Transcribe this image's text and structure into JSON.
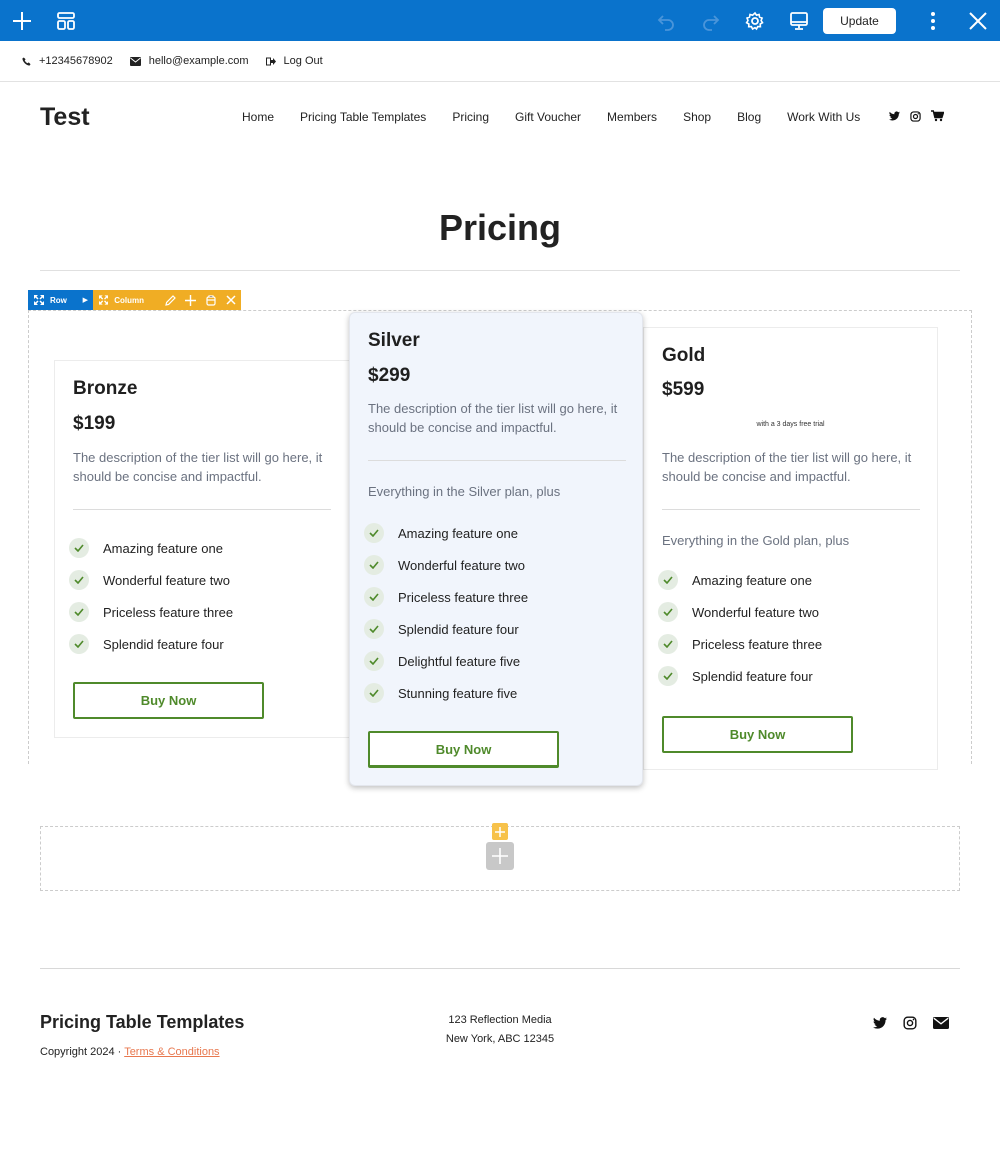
{
  "editor": {
    "update_label": "Update",
    "icons": [
      "plus-icon",
      "layout-icon",
      "undo-icon",
      "redo-icon",
      "settings-icon",
      "desktop-preview-icon",
      "more-vertical-icon",
      "close-icon"
    ],
    "accent": "#0a73cc"
  },
  "topbar": {
    "phone": "+12345678902",
    "email": "hello@example.com",
    "logout": "Log Out"
  },
  "header": {
    "site_title": "Test",
    "nav": [
      "Home",
      "Pricing Table Templates",
      "Pricing",
      "Gift Voucher",
      "Members",
      "Shop",
      "Blog",
      "Work With Us"
    ],
    "icons": [
      "twitter-icon",
      "instagram-icon",
      "cart-icon"
    ]
  },
  "page": {
    "title": "Pricing"
  },
  "builder": {
    "row_label": "Row",
    "column_label": "Column"
  },
  "plans": [
    {
      "name": "Bronze",
      "price": "$199",
      "description": "The description of the tier list will go here, it should be concise and impactful.",
      "features": [
        "Amazing feature one",
        "Wonderful feature two",
        "Priceless feature three",
        "Splendid feature four"
      ],
      "cta": "Buy Now"
    },
    {
      "name": "Silver",
      "price": "$299",
      "description": "The description of the tier list will go here, it should be concise and impactful.",
      "includes": "Everything in the Silver plan, plus",
      "features": [
        "Amazing feature one",
        "Wonderful feature two",
        "Priceless feature three",
        "Splendid feature four",
        "Delightful feature five",
        "Stunning feature five"
      ],
      "cta": "Buy Now"
    },
    {
      "name": "Gold",
      "price": "$599",
      "trial": "with a 3 days free trial",
      "description": "The description of the tier list will go here, it should be concise and impactful.",
      "includes": "Everything in the Gold plan, plus",
      "features": [
        "Amazing feature one",
        "Wonderful feature two",
        "Priceless feature three",
        "Splendid feature four"
      ],
      "cta": "Buy Now"
    }
  ],
  "footer": {
    "title": "Pricing Table Templates",
    "copyright": "Copyright 2024 · ",
    "terms": "Terms & Conditions",
    "address_line1": "123 Reflection Media",
    "address_line2": "New York, ABC 12345",
    "icons": [
      "twitter-icon",
      "instagram-icon",
      "email-icon"
    ]
  },
  "colors": {
    "button_green": "#4f8a2b",
    "link_orange": "#e8784f",
    "column_handle": "#f0ad24"
  }
}
